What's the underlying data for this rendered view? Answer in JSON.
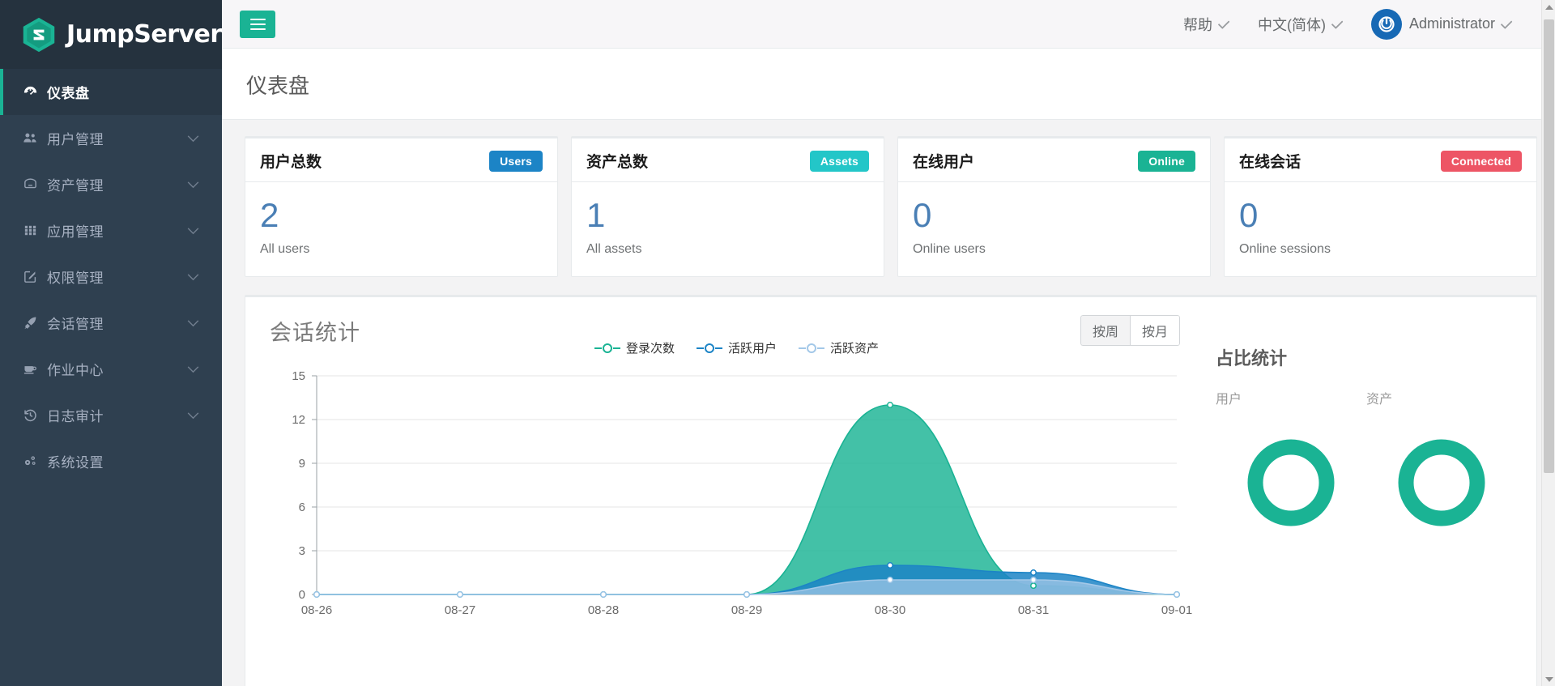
{
  "brand": {
    "name": "JumpServer",
    "logo_icon": "jumpserver-logo-icon"
  },
  "sidebar": {
    "items": [
      {
        "label": "仪表盘",
        "icon": "dashboard-icon",
        "active": true,
        "expandable": false
      },
      {
        "label": "用户管理",
        "icon": "users-icon",
        "active": false,
        "expandable": true
      },
      {
        "label": "资产管理",
        "icon": "assets-icon",
        "active": false,
        "expandable": true
      },
      {
        "label": "应用管理",
        "icon": "apps-grid-icon",
        "active": false,
        "expandable": true
      },
      {
        "label": "权限管理",
        "icon": "edit-square-icon",
        "active": false,
        "expandable": true
      },
      {
        "label": "会话管理",
        "icon": "rocket-icon",
        "active": false,
        "expandable": true
      },
      {
        "label": "作业中心",
        "icon": "coffee-icon",
        "active": false,
        "expandable": true
      },
      {
        "label": "日志审计",
        "icon": "history-icon",
        "active": false,
        "expandable": true
      },
      {
        "label": "系统设置",
        "icon": "settings-gears-icon",
        "active": false,
        "expandable": false
      }
    ]
  },
  "topbar": {
    "menu_toggle_icon": "hamburger-icon",
    "help_label": "帮助",
    "language_label": "中文(简体)",
    "user_label": "Administrator",
    "avatar_icon": "power-avatar-icon",
    "accent_green": "#1ab394"
  },
  "page": {
    "title": "仪表盘"
  },
  "cards": [
    {
      "title": "用户总数",
      "badge": "Users",
      "badge_color": "#1c84c6",
      "value": "2",
      "sub": "All users"
    },
    {
      "title": "资产总数",
      "badge": "Assets",
      "badge_color": "#23c6c8",
      "value": "1",
      "sub": "All assets"
    },
    {
      "title": "在线用户",
      "badge": "Online",
      "badge_color": "#1ab394",
      "value": "0",
      "sub": "Online users"
    },
    {
      "title": "在线会话",
      "badge": "Connected",
      "badge_color": "#ed5565",
      "value": "0",
      "sub": "Online sessions"
    }
  ],
  "session_panel": {
    "title": "会话统计",
    "range_buttons": [
      {
        "label": "按周",
        "active": true
      },
      {
        "label": "按月",
        "active": false
      }
    ]
  },
  "ratio_panel": {
    "title": "占比统计",
    "items": [
      {
        "label": "用户",
        "ring_color": "#1ab394"
      },
      {
        "label": "资产",
        "ring_color": "#1ab394"
      }
    ]
  },
  "chart_data": {
    "type": "area",
    "title": "会话统计",
    "xlabel": "",
    "ylabel": "",
    "grid": true,
    "legend_position": "top-center",
    "x": [
      "08-26",
      "08-27",
      "08-28",
      "08-29",
      "08-30",
      "08-31",
      "09-01"
    ],
    "yticks": [
      0,
      3,
      6,
      9,
      12,
      15
    ],
    "ylim": [
      0,
      15
    ],
    "series": [
      {
        "name": "登录次数",
        "color": "#1ab394",
        "values": [
          0,
          0,
          0,
          0,
          13,
          0.6,
          0
        ]
      },
      {
        "name": "活跃用户",
        "color": "#1c84c6",
        "values": [
          0,
          0,
          0,
          0,
          2,
          1.5,
          0
        ]
      },
      {
        "name": "活跃资产",
        "color": "#a3c8e8",
        "values": [
          0,
          0,
          0,
          0,
          1,
          1,
          0
        ]
      }
    ]
  }
}
